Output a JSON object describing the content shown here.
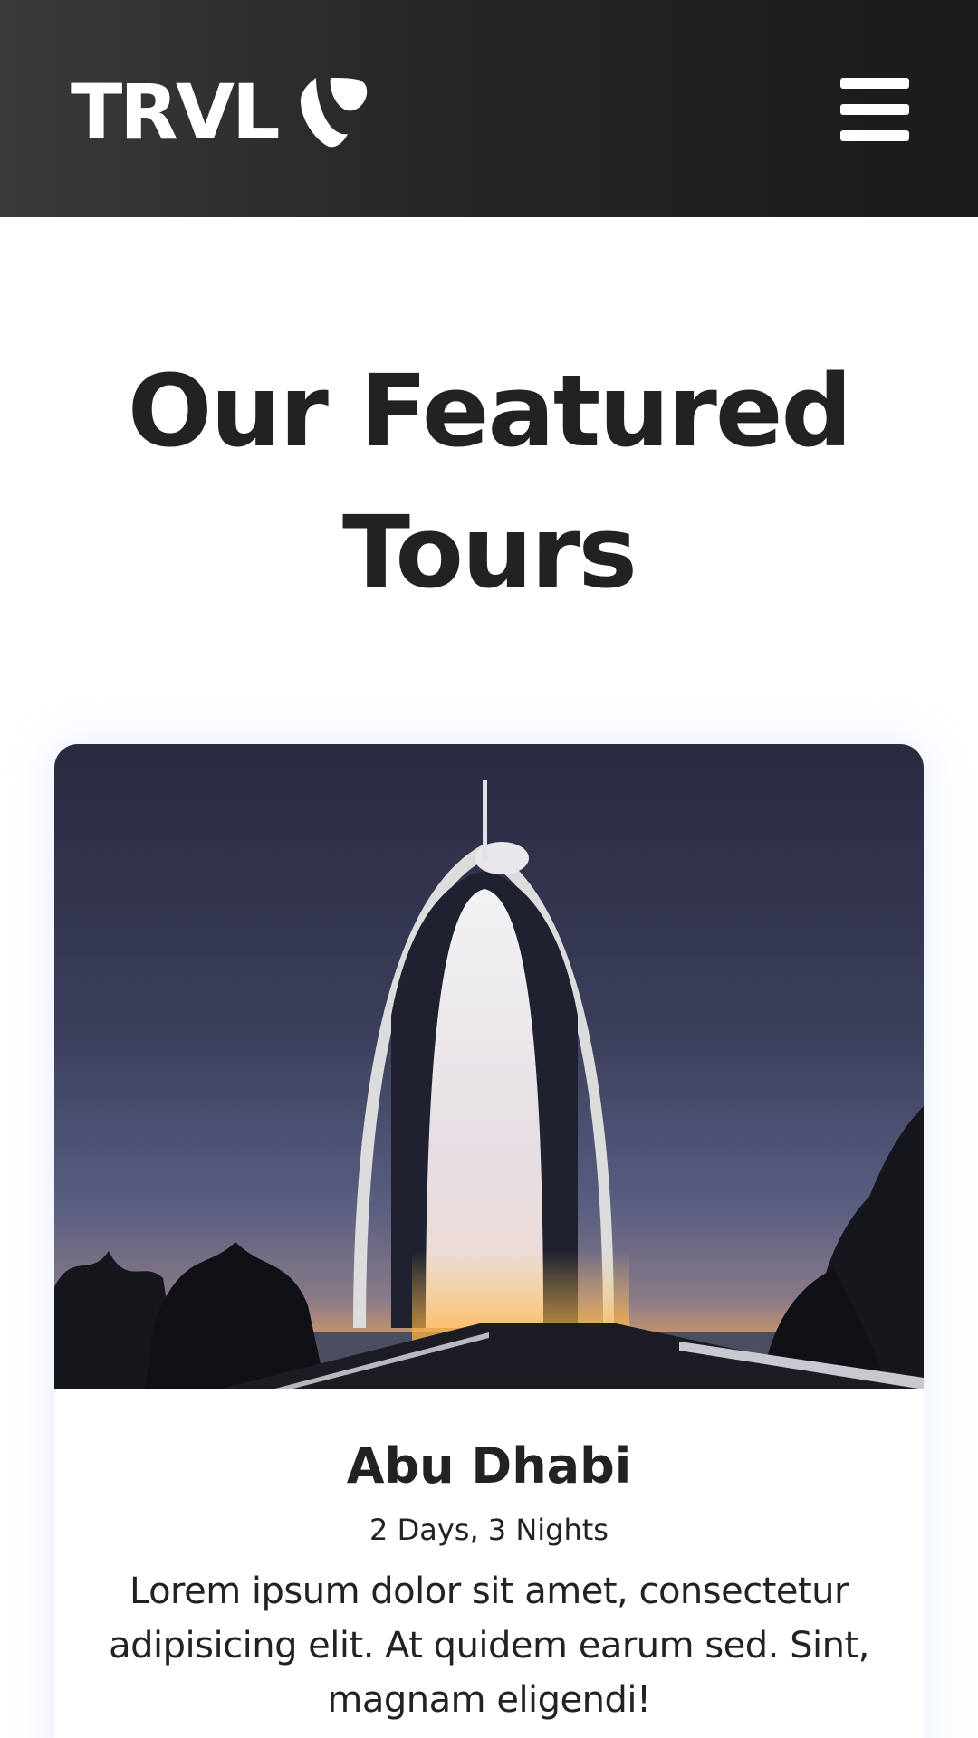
{
  "header": {
    "logo_text": "TRVL",
    "logo_icon": "typo3-icon",
    "menu_icon": "hamburger-menu-icon",
    "background_color": "#2a2a2a"
  },
  "main": {
    "section_title": "Our Featured Tours"
  },
  "tour_card": {
    "image_alt": "Burj Al Arab hotel at dusk",
    "title": "Abu Dhabi",
    "duration": "2 Days, 3 Nights",
    "description": "Lorem ipsum dolor sit amet, consectetur adipisicing elit. At quidem earum sed. Sint, magnam eligendi!"
  }
}
